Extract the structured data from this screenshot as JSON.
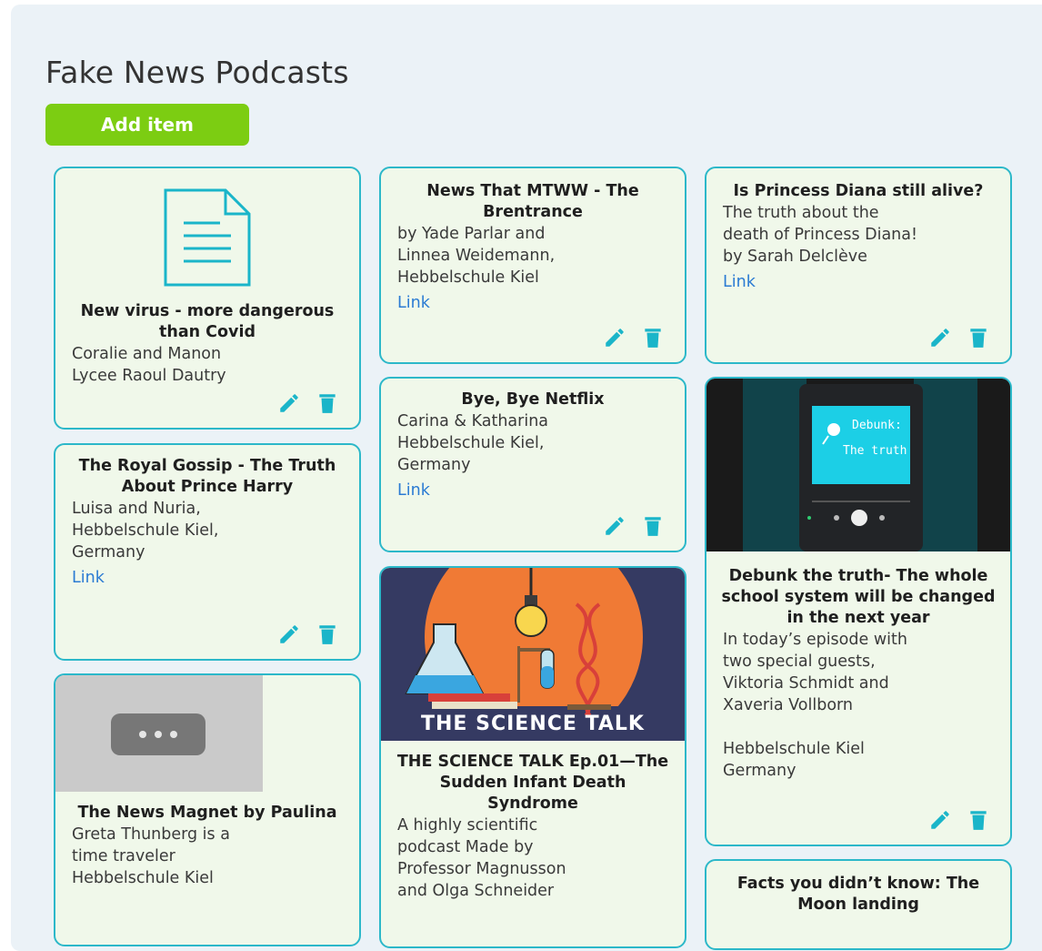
{
  "board": {
    "title": "Fake News Podcasts",
    "add_label": "Add item"
  },
  "colors": {
    "card_border": "#2cb8c9",
    "card_bg": "#f0f8ea",
    "accent_green": "#7ccd12",
    "icon_teal": "#1ab5c9",
    "link_blue": "#2b7bd3"
  },
  "icons": [
    "document-icon",
    "pencil-icon",
    "trash-icon",
    "ellipsis-icon"
  ],
  "cards": {
    "virus": {
      "title": "New virus - more dangerous than Covid",
      "body": "Coralie and Manon\nLycee Raoul Dautry"
    },
    "royal": {
      "title": "The Royal Gossip - The Truth About Prince Harry",
      "body": "Luisa and Nuria,\nHebbelschule Kiel,\nGermany",
      "link": "Link"
    },
    "magnet": {
      "title": "The News Magnet by Paulina",
      "body": "Greta Thunberg is a\ntime traveler\nHebbelschule Kiel"
    },
    "mtww": {
      "title": "News That MTWW - The Brentrance",
      "body": "by Yade Parlar and\nLinnea Weidemann,\nHebbelschule Kiel",
      "link": "Link"
    },
    "netflix": {
      "title": "Bye, Bye Netflix",
      "body": "Carina & Katharina\nHebbelschule Kiel,\nGermany",
      "link": "Link"
    },
    "science": {
      "banner": "THE SCIENCE TALK",
      "title": "THE SCIENCE TALK Ep.01—The Sudden Infant Death Syndrome",
      "body": "A highly scientific\npodcast Made by\nProfessor Magnusson\nand Olga Schneider"
    },
    "diana": {
      "title": "Is Princess Diana still alive?",
      "body": "The truth about the\ndeath of Princess Diana!\nby Sarah Delclève",
      "link": "Link"
    },
    "debunk": {
      "cover_line1": "Debunk:",
      "cover_line2": "The truth",
      "title": "Debunk the truth- The whole school system will be changed in the next year",
      "body": "In today’s episode with\ntwo special guests,\nViktoria Schmidt and\nXaveria Vollborn\n\nHebbelschule Kiel\nGermany"
    },
    "moon": {
      "title": "Facts you didn’t know: The Moon landing"
    }
  }
}
